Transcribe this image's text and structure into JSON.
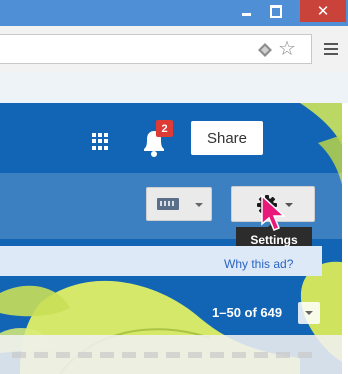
{
  "window": {
    "minimize_icon": "minimize-icon",
    "maximize_icon": "restore-icon",
    "close_label": "✕"
  },
  "browser": {
    "star_glyph": "☆",
    "icons": [
      "diamond-extension-icon",
      "star-icon",
      "menu-icon"
    ]
  },
  "header": {
    "notifications_count": "2",
    "share_label": "Share"
  },
  "toolbar": {
    "settings_tooltip": "Settings"
  },
  "ad": {
    "why_label": "Why this ad?"
  },
  "pagination": {
    "range_label": "1–50 of 649"
  },
  "colors": {
    "titlebar": "#4f8fd6",
    "close": "#c9433b",
    "theme_blue": "#1265b5",
    "leaf_green": "#cde45a",
    "badge_red": "#dd3b35",
    "cursor_pink": "#e8197a"
  }
}
